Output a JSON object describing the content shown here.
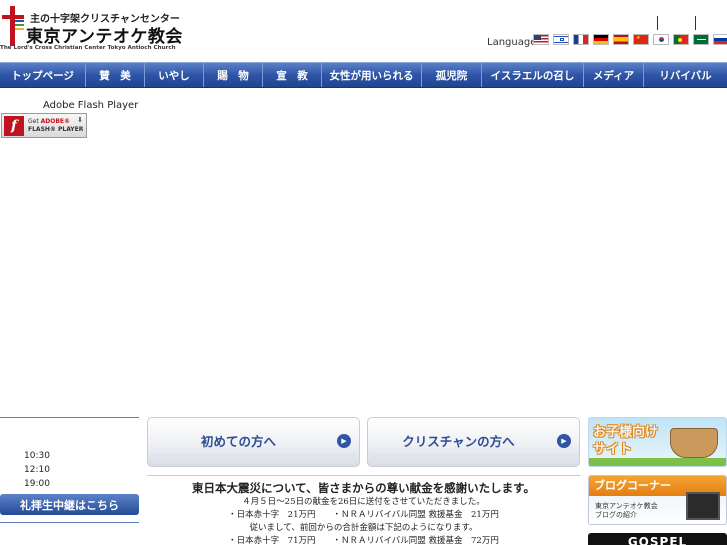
{
  "header": {
    "logo_subtitle": "主の十字架クリスチャンセンター",
    "logo_title": "東京アンテオケ教会",
    "logo_english": "The Lord's Cross Christian Center Tokyo Antioch Church",
    "language_label": "Language",
    "flags": [
      "us-flag",
      "israel-flag",
      "france-flag",
      "germany-flag",
      "spain-flag",
      "china-flag",
      "korea-flag",
      "portugal-flag",
      "saudi-flag",
      "russia-flag"
    ]
  },
  "nav": {
    "items": [
      {
        "label": "トップページ"
      },
      {
        "label": "賛　美"
      },
      {
        "label": "いやし"
      },
      {
        "label": "賜　物"
      },
      {
        "label": "宣　教"
      },
      {
        "label": "女性が用いられる"
      },
      {
        "label": "孤児院"
      },
      {
        "label": "イスラエルの召し"
      },
      {
        "label": "メディア"
      },
      {
        "label": "リバイバル"
      }
    ]
  },
  "flash": {
    "player_label": "Adobe Flash Player",
    "badge_get": "Get",
    "badge_adobe": "ADOBE®",
    "badge_product": "FLASH® PLAYER"
  },
  "service": {
    "times": [
      "10:30",
      "12:10",
      "19:00"
    ],
    "stream_button": "礼拝生中継はこちら"
  },
  "cta": {
    "first_time": "初めての方へ",
    "christians": "クリスチャンの方へ"
  },
  "announcement": {
    "title": "東日本大震災について、皆さまからの尊い献金を感謝いたします。",
    "lines": [
      "４月５日～25日の献金を26日に送付をさせていただきました。",
      "・日本赤十字　21万円　　・ＮＲＡリバイバル同盟 救援基金　21万円",
      "従いまして、前回からの合計金額は下記のようになります。",
      "・日本赤十字　71万円　　・ＮＲＡリバイバル同盟 救援基金　72万円"
    ]
  },
  "banners": {
    "kids_line1": "お子様向け",
    "kids_line2": "サイト",
    "blog_title": "ブログコーナー",
    "blog_line1": "東京アンテオケ教会",
    "blog_line2": "ブログの紹介",
    "gospel": "GOSPEL"
  },
  "colors": {
    "nav_blue": "#2f55a6",
    "logo_red": "#c1121f",
    "accent_orange": "#e47d12"
  }
}
